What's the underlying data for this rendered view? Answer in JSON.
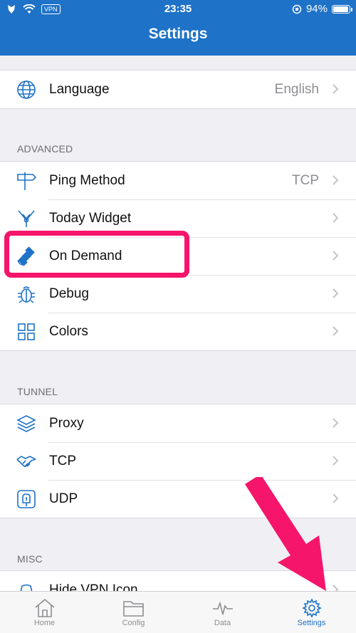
{
  "status_bar": {
    "vpn": "VPN",
    "time": "23:35",
    "battery": "94%",
    "battery_level": 0.94
  },
  "header": {
    "title": "Settings"
  },
  "general": {
    "items": [
      {
        "label": "Language",
        "value": "English",
        "icon": "globe-icon"
      }
    ]
  },
  "advanced": {
    "header": "ADVANCED",
    "items": [
      {
        "label": "Ping Method",
        "value": "TCP",
        "icon": "signpost-icon"
      },
      {
        "label": "Today Widget",
        "icon": "widget-icon"
      },
      {
        "label": "On Demand",
        "icon": "satellite-icon"
      },
      {
        "label": "Debug",
        "icon": "bug-icon"
      },
      {
        "label": "Colors",
        "icon": "grid-icon"
      }
    ]
  },
  "tunnel": {
    "header": "TUNNEL",
    "items": [
      {
        "label": "Proxy",
        "icon": "layers-icon"
      },
      {
        "label": "TCP",
        "icon": "handshake-icon"
      },
      {
        "label": "UDP",
        "icon": "plug-icon"
      }
    ]
  },
  "misc": {
    "header": "MISC",
    "items": [
      {
        "label": "Hide VPN Icon",
        "icon": "hat-icon"
      }
    ]
  },
  "tabbar": {
    "tabs": [
      {
        "label": "Home",
        "icon": "home-icon"
      },
      {
        "label": "Config",
        "icon": "folder-icon"
      },
      {
        "label": "Data",
        "icon": "pulse-icon"
      },
      {
        "label": "Settings",
        "icon": "gear-icon",
        "active": true
      }
    ]
  },
  "colors": {
    "accent": "#1e72c7",
    "highlight": "#f5156b"
  }
}
